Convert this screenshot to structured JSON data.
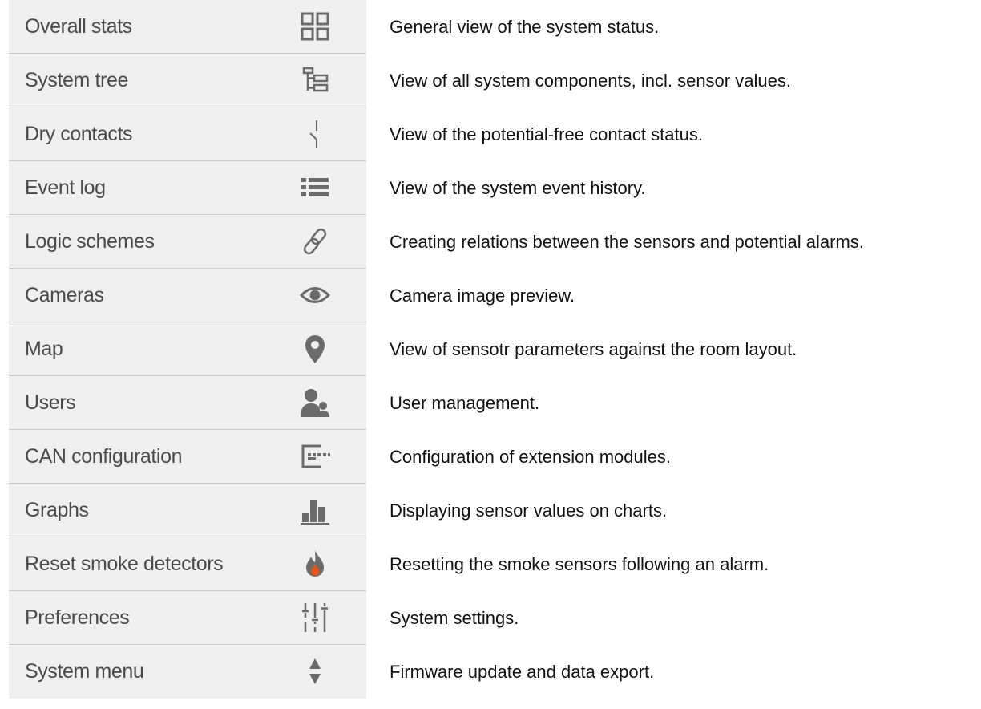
{
  "menu": {
    "items": [
      {
        "label": "Overall stats",
        "icon": "grid-icon",
        "description": "General view of the system status."
      },
      {
        "label": "System tree",
        "icon": "tree-icon",
        "description": "View of all system components, incl. sensor values."
      },
      {
        "label": "Dry contacts",
        "icon": "switch-contact-icon",
        "description": "View of the potential-free contact status."
      },
      {
        "label": "Event log",
        "icon": "list-icon",
        "description": "View of the system event history."
      },
      {
        "label": "Logic schemes",
        "icon": "link-icon",
        "description": "Creating relations between the sensors and potential alarms."
      },
      {
        "label": "Cameras",
        "icon": "eye-icon",
        "description": "Camera image preview."
      },
      {
        "label": "Map",
        "icon": "map-pin-icon",
        "description": "View of sensotr parameters against the room layout."
      },
      {
        "label": "Users",
        "icon": "users-icon",
        "description": "User management."
      },
      {
        "label": "CAN configuration",
        "icon": "module-icon",
        "description": "Configuration of extension modules."
      },
      {
        "label": "Graphs",
        "icon": "bar-chart-icon",
        "description": "Displaying sensor values on charts."
      },
      {
        "label": "Reset smoke detectors",
        "icon": "flame-icon",
        "description": "Resetting the smoke sensors following an alarm."
      },
      {
        "label": "Preferences",
        "icon": "sliders-icon",
        "description": "System settings."
      },
      {
        "label": "System menu",
        "icon": "up-down-arrows-icon",
        "description": "Firmware update and data export."
      }
    ]
  },
  "colors": {
    "menu_background": "#efefef",
    "menu_divider": "#c9c9c9",
    "menu_text": "#4a4a4a",
    "icon": "#6b6b6b",
    "description_text": "#111111"
  }
}
